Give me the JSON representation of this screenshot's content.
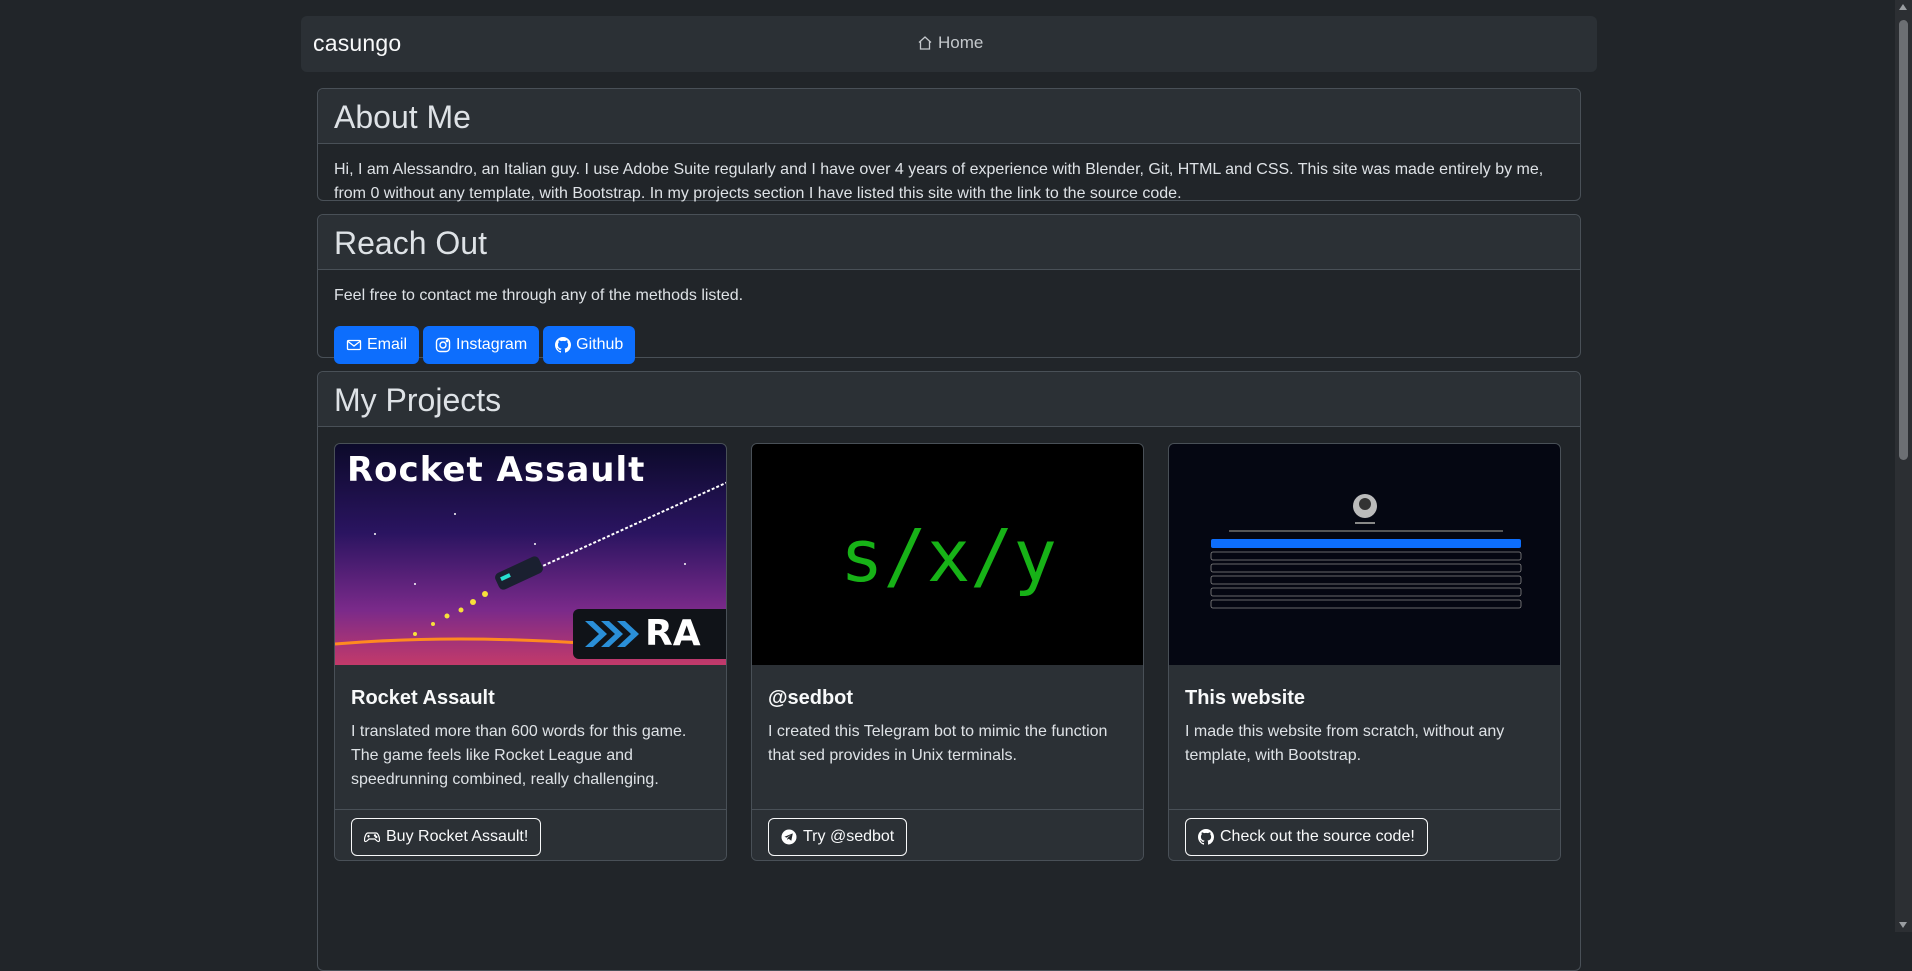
{
  "navbar": {
    "brand": "casungo",
    "home_label": "Home"
  },
  "about": {
    "title": "About Me",
    "text": "Hi, I am Alessandro, an Italian guy. I use Adobe Suite regularly and I have over 4 years of experience with Blender, Git, HTML and CSS. This site was made entirely by me, from 0 without any template, with Bootstrap. In my projects section I have listed this site with the link to the source code."
  },
  "reach": {
    "title": "Reach Out",
    "text": "Feel free to contact me through any of the methods listed.",
    "buttons": [
      {
        "label": "Email",
        "icon": "envelope-icon"
      },
      {
        "label": "Instagram",
        "icon": "instagram-icon"
      },
      {
        "label": "Github",
        "icon": "github-icon"
      }
    ]
  },
  "projects": {
    "title": "My Projects",
    "items": [
      {
        "image_text": "Rocket Assault",
        "image_badge": "RA",
        "title": "Rocket Assault",
        "text": "I translated more than 600 words for this game. The game feels like Rocket League and speedrunning combined, really challenging.",
        "button": "Buy Rocket Assault!",
        "icon": "gamepad-icon"
      },
      {
        "image_text": "s/x/y",
        "title": "@sedbot",
        "text": "I created this Telegram bot to mimic the function that sed provides in Unix terminals.",
        "button": "Try @sedbot",
        "icon": "telegram-icon"
      },
      {
        "title": "This website",
        "text": "I made this website from scratch, without any template, with Bootstrap.",
        "button": "Check out the source code!",
        "icon": "github-icon"
      }
    ]
  },
  "colors": {
    "background": "#212529",
    "primary": "#0d6efd",
    "card": "#2b3035",
    "sed_green": "#17b217"
  }
}
